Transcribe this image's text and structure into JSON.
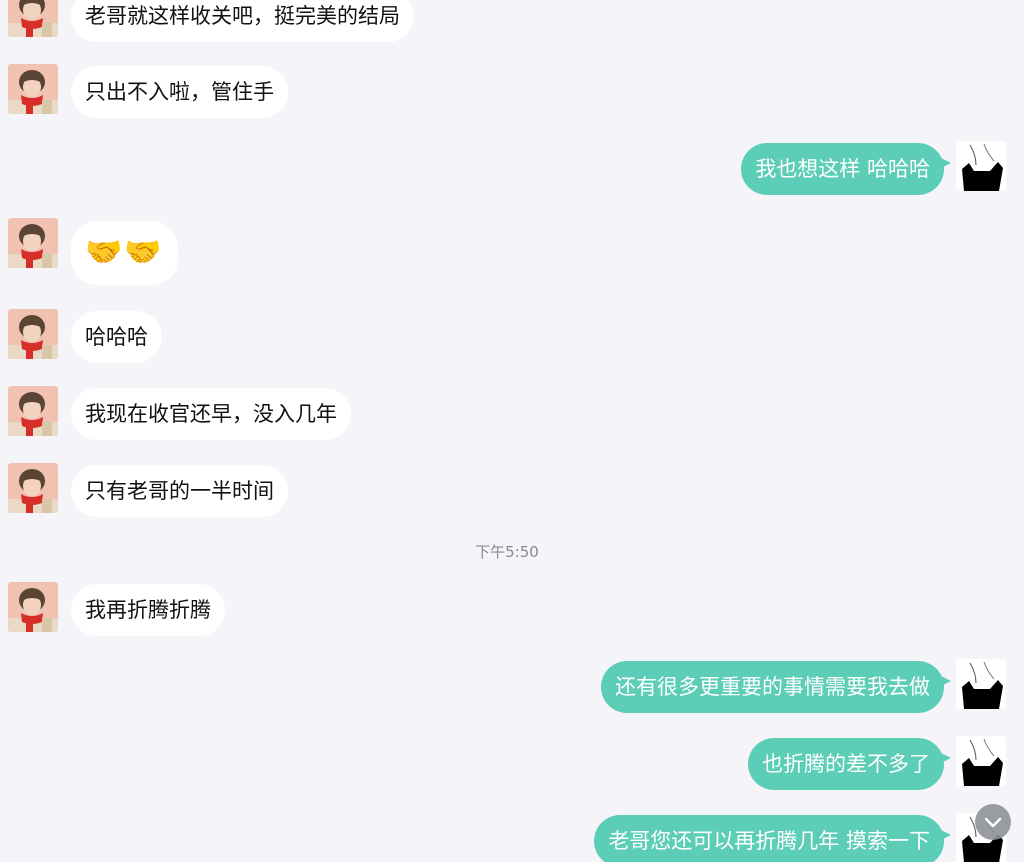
{
  "messages": [
    {
      "side": "in",
      "text": "老哥就这样收关吧，挺完美的结局"
    },
    {
      "side": "in",
      "text": "只出不入啦，管住手"
    },
    {
      "side": "out",
      "text": "我也想这样 哈哈哈"
    },
    {
      "side": "in",
      "text": "🤝🤝"
    },
    {
      "side": "in",
      "text": "哈哈哈"
    },
    {
      "side": "in",
      "text": "我现在收官还早，没入几年"
    },
    {
      "side": "in",
      "text": "只有老哥的一半时间"
    },
    {
      "side": "in",
      "text": "我再折腾折腾"
    },
    {
      "side": "out",
      "text": "还有很多更重要的事情需要我去做"
    },
    {
      "side": "out",
      "text": "也折腾的差不多了"
    },
    {
      "side": "out",
      "text": "老哥您还可以再折腾几年 摸索一下"
    }
  ],
  "timestamp": "下午5:50",
  "colors": {
    "background": "#f4f4f9",
    "incoming_bubble": "#ffffff",
    "outgoing_bubble": "#5ccdb6"
  },
  "icons": {
    "contact_avatar": "avatar-girl-red-scarf-icon",
    "self_avatar": "avatar-black-cat-silhouette-icon",
    "scroll_down": "chevron-down-icon"
  }
}
